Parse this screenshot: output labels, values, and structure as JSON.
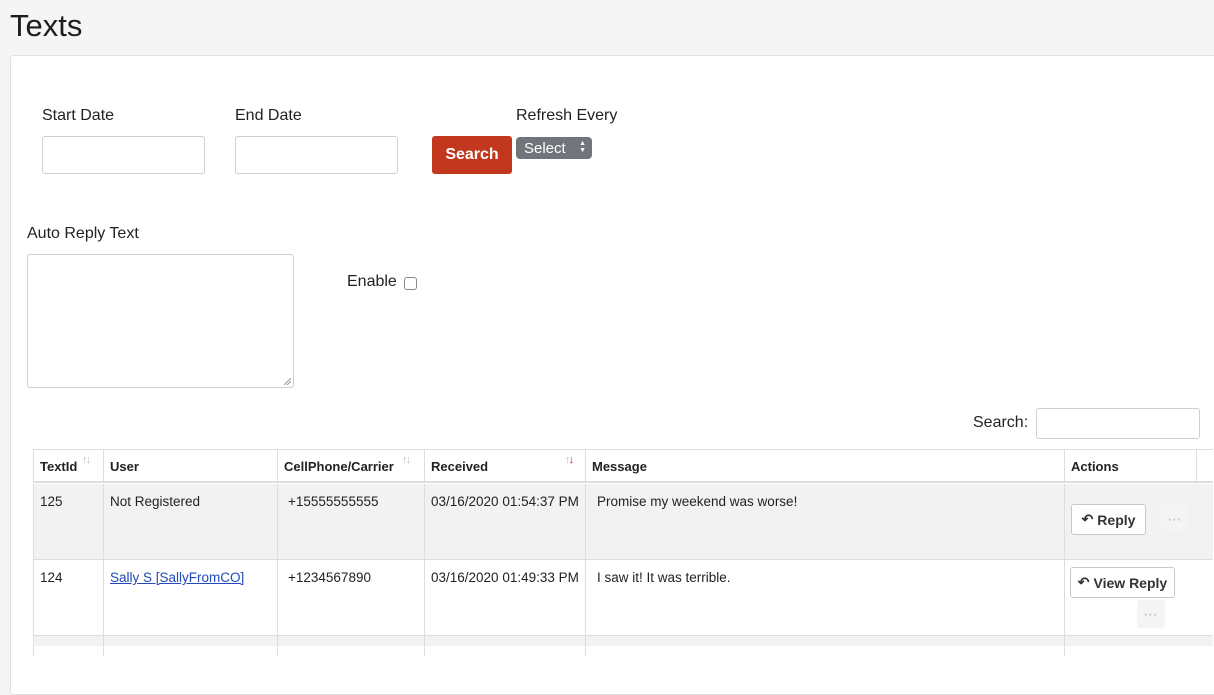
{
  "page": {
    "title": "Texts"
  },
  "filters": {
    "start_date_label": "Start Date",
    "start_date_value": "",
    "end_date_label": "End Date",
    "end_date_value": "",
    "search_button": "Search",
    "refresh_label": "Refresh Every",
    "refresh_select_value": "Select"
  },
  "auto_reply": {
    "label": "Auto Reply Text",
    "value": "",
    "enable_label": "Enable",
    "enable_checked": false
  },
  "table": {
    "search_label": "Search:",
    "search_value": "",
    "columns": [
      "TextId",
      "User",
      "CellPhone/Carrier",
      "Received",
      "Message",
      "Actions"
    ],
    "sort_indicator": "↑↓",
    "rows": [
      {
        "text_id": "125",
        "user": "Not Registered",
        "user_is_link": false,
        "cell_phone": "+15555555555",
        "received": "03/16/2020 01:54:37 PM",
        "message": "Promise my weekend was worse!",
        "action_label": "Reply"
      },
      {
        "text_id": "124",
        "user": "Sally S [SallyFromCO]",
        "user_is_link": true,
        "cell_phone": "+1234567890",
        "received": "03/16/2020 01:49:33 PM",
        "message": "I saw it! It was terrible.",
        "action_label": "View Reply"
      }
    ],
    "more_icon": "⋯"
  },
  "colors": {
    "search_button": "#c1381f",
    "select_bg": "#6f757a",
    "link": "#2149b8",
    "sort_active": "#d01c1c"
  },
  "icons": {
    "reply": "reply-arrow-icon",
    "more": "ellipsis-icon"
  }
}
